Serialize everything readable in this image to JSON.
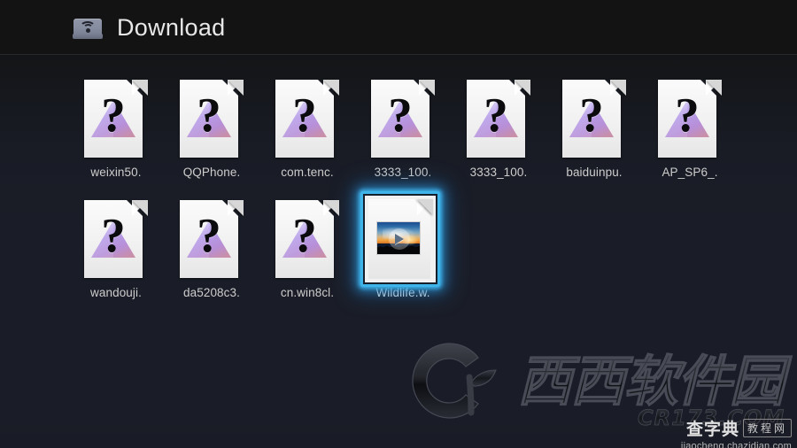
{
  "header": {
    "title": "Download",
    "icon": "network-drive-icon"
  },
  "colors": {
    "header_bg": "#131314",
    "body_bg": "#1a1d27",
    "title_text": "#e8e8e8",
    "label_text": "#cdcdcd",
    "selection_border": "#3fb4e8",
    "selection_glow": "#2d96d7",
    "page_white": "#f6f6f6",
    "triangle_top": "#cfc6f2",
    "triangle_left": "#a98ce6",
    "triangle_right": "#c98fb0"
  },
  "grid": {
    "rows": [
      {
        "items": [
          {
            "label": "weixin50.",
            "icon": "unknown-file-icon",
            "kind": "unknown",
            "selected": false
          },
          {
            "label": "QQPhone.",
            "icon": "unknown-file-icon",
            "kind": "unknown",
            "selected": false
          },
          {
            "label": "com.tenc.",
            "icon": "unknown-file-icon",
            "kind": "unknown",
            "selected": false
          },
          {
            "label": "3333_100.",
            "icon": "unknown-file-icon",
            "kind": "unknown",
            "selected": false
          },
          {
            "label": "3333_100.",
            "icon": "unknown-file-icon",
            "kind": "unknown",
            "selected": false
          },
          {
            "label": "baiduinpu.",
            "icon": "unknown-file-icon",
            "kind": "unknown",
            "selected": false
          },
          {
            "label": "AP_SP6_.",
            "icon": "unknown-file-icon",
            "kind": "unknown",
            "selected": false
          }
        ]
      },
      {
        "items": [
          {
            "label": "wandouji.",
            "icon": "unknown-file-icon",
            "kind": "unknown",
            "selected": false
          },
          {
            "label": "da5208c3.",
            "icon": "unknown-file-icon",
            "kind": "unknown",
            "selected": false
          },
          {
            "label": "cn.win8cl.",
            "icon": "unknown-file-icon",
            "kind": "unknown",
            "selected": false
          },
          {
            "label": "Wildlife.w.",
            "icon": "video-file-icon",
            "kind": "video",
            "selected": true
          }
        ]
      }
    ]
  },
  "watermark": {
    "logo_mark": "cr-leaf-logo",
    "brand_cn": "西西软件园",
    "brand_url": "CR173.COM"
  },
  "watermark_secondary": {
    "brand_cn": "查字典",
    "brand_tag": "教程网",
    "url": "jiaocheng.chazidian.com"
  }
}
